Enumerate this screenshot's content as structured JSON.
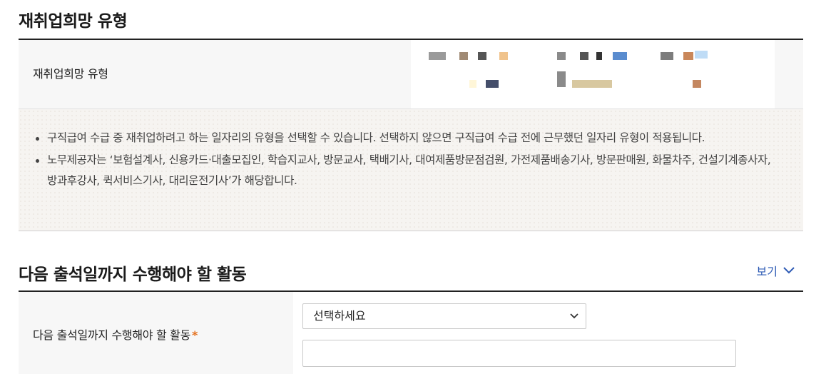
{
  "section1": {
    "title": "재취업희망 유형",
    "row_label": "재취업희망 유형"
  },
  "notice": {
    "items": [
      "구직급여 수급 중 재취업하려고 하는 일자리의 유형을 선택할 수 있습니다. 선택하지 않으면 구직급여 수급 전에 근무했던 일자리 유형이 적용됩니다.",
      "노무제공자는 ‘보험설계사, 신용카드·대출모집인, 학습지교사, 방문교사, 택배기사, 대여제품방문점검원, 가전제품배송기사, 방문판매원, 화물차주, 건설기계종사자, 방과후강사, 퀵서비스기사, 대리운전기사’가 해당합니다."
    ]
  },
  "section2": {
    "title": "다음 출석일까지 수행해야 할 활동",
    "view_label": "보기",
    "row_label": "다음 출석일까지 수행해야 할 활동",
    "required_mark": "*",
    "select_value": "선택하세요",
    "text_value": ""
  },
  "colors": {
    "link": "#2e5bb5",
    "required": "#e4711f",
    "rule": "#222222"
  },
  "icons": {
    "view_toggle": "chevron-down-icon",
    "select_arrow": "chevron-down-icon"
  }
}
